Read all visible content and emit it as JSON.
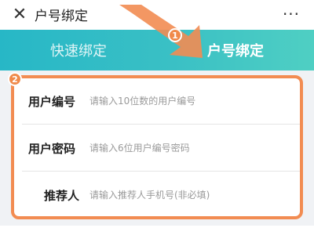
{
  "header": {
    "close_icon": "close-icon",
    "title": "户号绑定",
    "more_icon": "more-options-icon",
    "more_glyph": "···"
  },
  "tabs": [
    {
      "label": "快速绑定",
      "selected": false
    },
    {
      "label": "户号绑定",
      "selected": true
    }
  ],
  "annotations": {
    "badge_1": "1",
    "badge_2": "2",
    "highlight_color": "#f28c52"
  },
  "form": {
    "fields": [
      {
        "label": "用户编号",
        "placeholder": "请输入10位数的用户编号",
        "value": ""
      },
      {
        "label": "用户密码",
        "placeholder": "请输入6位用户编号密码",
        "value": ""
      },
      {
        "label": "推荐人",
        "placeholder": "请输入推荐人手机号(非必填)",
        "value": ""
      }
    ]
  },
  "colors": {
    "accent_teal": "#2fbac6",
    "annotation_orange": "#f28c52"
  }
}
